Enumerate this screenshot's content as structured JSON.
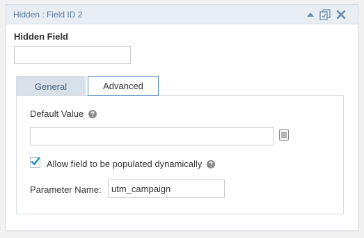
{
  "header": {
    "title": "Hidden : Field ID 2",
    "icons": [
      "collapse-arrow-icon",
      "duplicate-icon",
      "close-icon"
    ]
  },
  "field": {
    "label": "Hidden Field",
    "value": ""
  },
  "tabs": [
    {
      "label": "General",
      "active": false
    },
    {
      "label": "Advanced",
      "active": true
    }
  ],
  "advanced": {
    "default_value_label": "Default Value",
    "default_value": "",
    "allow_dynamic_label": "Allow field to be populated dynamically",
    "allow_dynamic_checked": true,
    "parameter_label": "Parameter Name:",
    "parameter_value": "utm_campaign"
  },
  "colors": {
    "header_bg": "#e8eef4",
    "title_text": "#5a7898",
    "active_tab_border": "#4f87ba",
    "inactive_tab_bg": "#d8e1ea",
    "check_color": "#1e8cbe"
  }
}
